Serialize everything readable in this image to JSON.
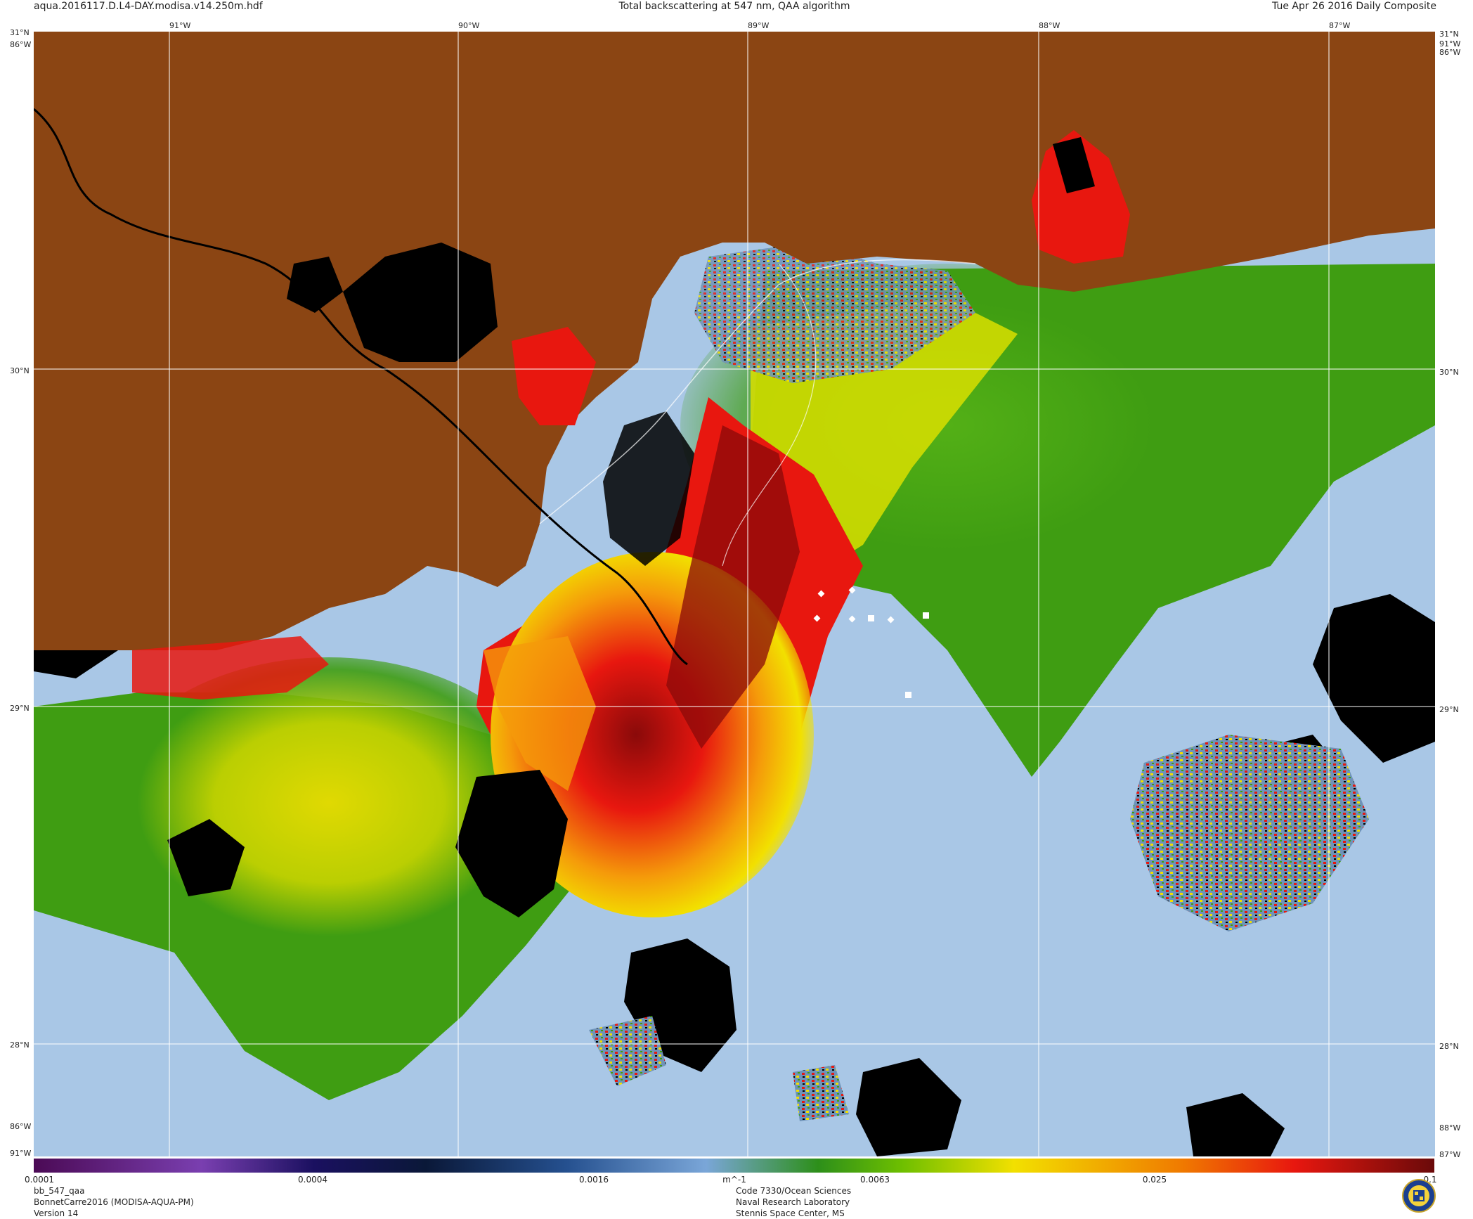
{
  "header": {
    "filename": "aqua.2016117.D.L4-DAY.modisa.v14.250m.hdf",
    "title": "Total backscattering at 547 nm, QAA algorithm",
    "date": "Tue Apr 26 2016 Daily Composite"
  },
  "axes": {
    "lon_top": [
      "91°W",
      "90°W",
      "89°W",
      "88°W",
      "87°W"
    ],
    "lat_left": [
      "31°N",
      "30°N",
      "29°N",
      "28°N"
    ],
    "lat_right": [
      "31°N",
      "30°N",
      "29°N",
      "28°N"
    ],
    "corner_top_left": "31°N",
    "corner_top_left_lon": "86°W",
    "corner_top_right_lat": "31°N",
    "corner_top_right_lon": "91°W",
    "corner_top_right_lon2": "86°W",
    "corner_bottom_left_lat": "28°N",
    "corner_bottom_left_lon": "86°W",
    "corner_bottom_left_lon2": "91°W",
    "corner_bottom_right_lon": "88°W",
    "corner_bottom_right_lon2": "87°W"
  },
  "colorbar": {
    "ticks": [
      "0.0001",
      "0.0004",
      "0.0016",
      "m^-1",
      "0.0063",
      "0.025",
      "0.1"
    ],
    "scale": "log"
  },
  "footer": {
    "left": [
      "bb_547_qaa",
      "BonnetCarre2016 (MODISA-AQUA-PM)",
      "Version 14"
    ],
    "center": [
      "Code 7330/Ocean Sciences",
      "Naval Research Laboratory",
      "Stennis Space Center, MS"
    ]
  },
  "colors": {
    "land": "#8B4513",
    "nodata": "#000000",
    "clear_water": "#a9c7e6",
    "low": "#3f9d12",
    "mid": "#f2e000",
    "high": "#e8170f",
    "very_high": "#8a0a0a",
    "grid": "#ffffff"
  }
}
